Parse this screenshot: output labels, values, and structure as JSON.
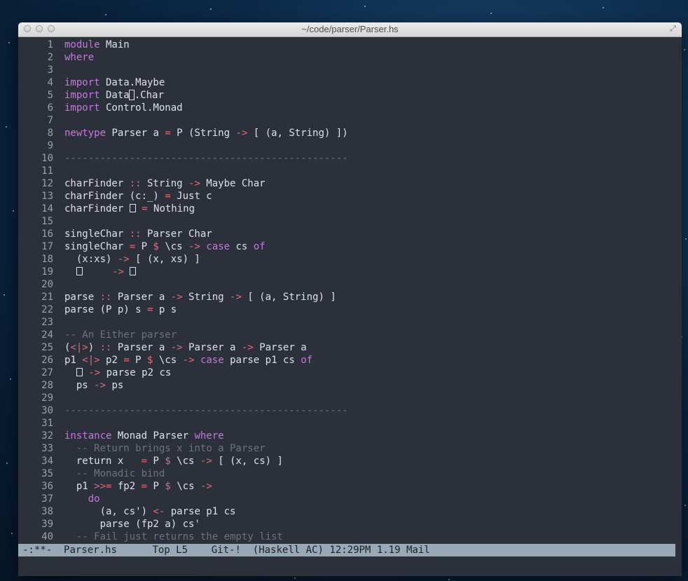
{
  "window": {
    "title": "~/code/parser/Parser.hs"
  },
  "colors": {
    "background": "#2b303b",
    "keyword": "#c678dd",
    "type": "#e6c07b",
    "operator": "#e06c75",
    "comment": "#6b7380",
    "text": "#dfe1e8",
    "modeline": "#98a8b5"
  },
  "icons": {
    "close": "close-icon",
    "minimize": "minimize-icon",
    "zoom": "zoom-icon",
    "fullscreen": "fullscreen-icon"
  },
  "editor": {
    "lines": [
      {
        "n": "1",
        "t": "module Main"
      },
      {
        "n": "2",
        "t": "where"
      },
      {
        "n": "3",
        "t": ""
      },
      {
        "n": "4",
        "t": "import Data.Maybe"
      },
      {
        "n": "5",
        "t": "import Data.Char"
      },
      {
        "n": "6",
        "t": "import Control.Monad"
      },
      {
        "n": "7",
        "t": ""
      },
      {
        "n": "8",
        "t": "newtype Parser a = P (String -> [ (a, String) ])"
      },
      {
        "n": "9",
        "t": ""
      },
      {
        "n": "10",
        "t": "------------------------------------------------"
      },
      {
        "n": "11",
        "t": ""
      },
      {
        "n": "12",
        "t": "charFinder :: String -> Maybe Char"
      },
      {
        "n": "13",
        "t": "charFinder (c:_) = Just c"
      },
      {
        "n": "14",
        "t": "charFinder [] = Nothing"
      },
      {
        "n": "15",
        "t": ""
      },
      {
        "n": "16",
        "t": "singleChar :: Parser Char"
      },
      {
        "n": "17",
        "t": "singleChar = P $ \\cs -> case cs of"
      },
      {
        "n": "18",
        "t": "  (x:xs) -> [ (x, xs) ]"
      },
      {
        "n": "19",
        "t": "  []     -> []"
      },
      {
        "n": "20",
        "t": ""
      },
      {
        "n": "21",
        "t": "parse :: Parser a -> String -> [ (a, String) ]"
      },
      {
        "n": "22",
        "t": "parse (P p) s = p s"
      },
      {
        "n": "23",
        "t": ""
      },
      {
        "n": "24",
        "t": "-- An Either parser"
      },
      {
        "n": "25",
        "t": "(<|>) :: Parser a -> Parser a -> Parser a"
      },
      {
        "n": "26",
        "t": "p1 <|> p2 = P $ \\cs -> case parse p1 cs of"
      },
      {
        "n": "27",
        "t": "  [] -> parse p2 cs"
      },
      {
        "n": "28",
        "t": "  ps -> ps"
      },
      {
        "n": "29",
        "t": ""
      },
      {
        "n": "30",
        "t": "------------------------------------------------"
      },
      {
        "n": "31",
        "t": ""
      },
      {
        "n": "32",
        "t": "instance Monad Parser where"
      },
      {
        "n": "33",
        "t": "  -- Return brings x into a Parser"
      },
      {
        "n": "34",
        "t": "  return x   = P $ \\cs -> [ (x, cs) ]"
      },
      {
        "n": "35",
        "t": "  -- Monadic bind"
      },
      {
        "n": "36",
        "t": "  p1 >>= fp2 = P $ \\cs ->"
      },
      {
        "n": "37",
        "t": "    do"
      },
      {
        "n": "38",
        "t": "      (a, cs') <- parse p1 cs"
      },
      {
        "n": "39",
        "t": "      parse (fp2 a) cs'"
      },
      {
        "n": "40",
        "t": "  -- Fail just returns the empty list"
      }
    ]
  },
  "modeline": {
    "status": "-:**-",
    "buffer": "Parser.hs",
    "position": "Top L5",
    "vc": "Git-!",
    "mode": "(Haskell AC)",
    "time": "12:29PM",
    "load": "1.19",
    "mail": "Mail"
  }
}
